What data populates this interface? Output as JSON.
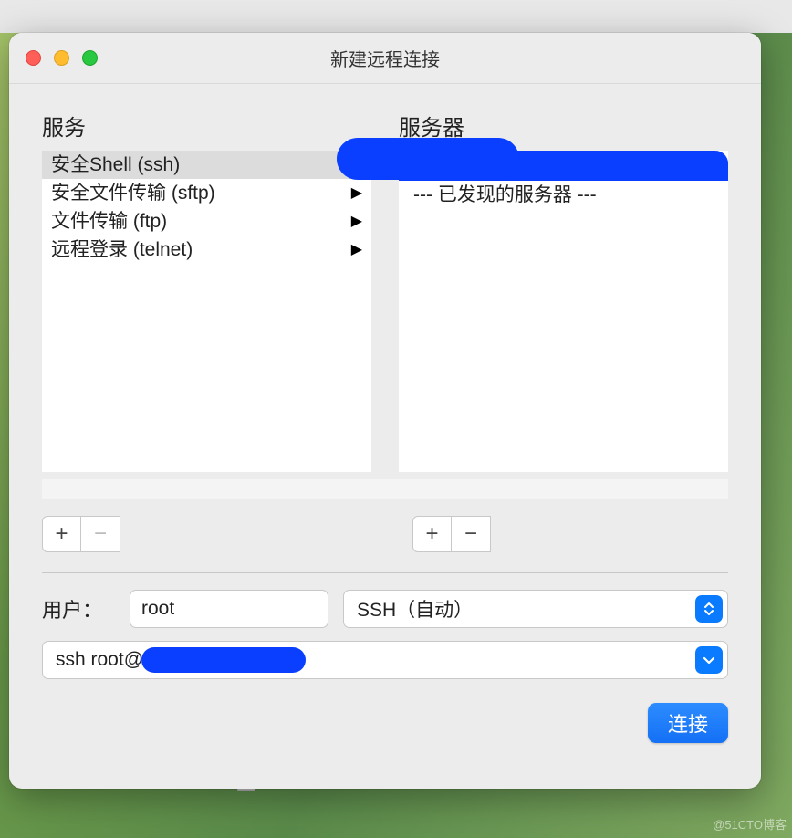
{
  "window": {
    "title": "新建远程连接"
  },
  "panels": {
    "services_header": "服务",
    "servers_header": "服务器"
  },
  "services": [
    {
      "label": "安全Shell (ssh)",
      "has_arrow": false,
      "selected": true
    },
    {
      "label": "安全文件传输 (sftp)",
      "has_arrow": true,
      "selected": false
    },
    {
      "label": "文件传输 (ftp)",
      "has_arrow": true,
      "selected": false
    },
    {
      "label": "远程登录 (telnet)",
      "has_arrow": true,
      "selected": false
    }
  ],
  "servers": {
    "discovered_label": "--- 已发现的服务器 ---"
  },
  "buttons": {
    "plus": "+",
    "minus": "−"
  },
  "form": {
    "user_label": "用户：",
    "user_value": "root",
    "protocol_value": "SSH（自动）",
    "command_prefix": "ssh root@"
  },
  "footer": {
    "connect_label": "连接"
  },
  "watermark": "@51CTO博客"
}
